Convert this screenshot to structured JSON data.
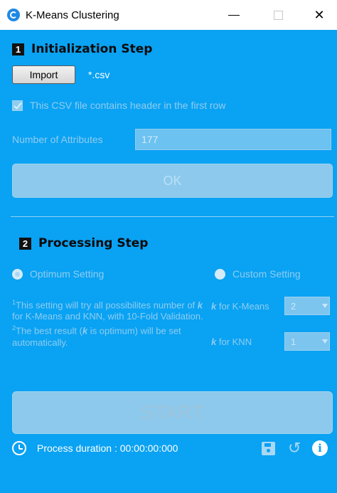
{
  "window": {
    "title": "K-Means Clustering",
    "min_glyph": "—",
    "max_glyph": "□",
    "close_glyph": "✕"
  },
  "init": {
    "step_number": "1",
    "title": "Initialization Step",
    "import_label": "Import",
    "file_label": "*.csv",
    "header_checkbox_label": "This CSV file contains header in the first row",
    "header_checked": true,
    "attributes_label": "Number of Attributes",
    "attributes_value": "177",
    "ok_label": "OK"
  },
  "processing": {
    "step_number": "2",
    "title": "Processing Step",
    "optimum_label": "Optimum Setting",
    "custom_label": "Custom Setting",
    "selected": "optimum",
    "info_line1_pre": "This setting will try all possibilites number of ",
    "info_line1_k": "k",
    "info_line1_post": " for K-Means and KNN, with 10-Fold Validation.",
    "info_line2_pre": "The best result (",
    "info_line2_k": "k",
    "info_line2_post": " is optimum) will be set automatically.",
    "sup1": "1",
    "sup2": "2",
    "k_symbol": "k",
    "k_kmeans_label": " for K-Means",
    "k_kmeans_value": "2",
    "k_knn_label": " for KNN",
    "k_knn_value": "1",
    "start_label": "START"
  },
  "footer": {
    "duration_text": "Process duration : 00:00:00:000",
    "icons": [
      "clock-icon",
      "save-icon",
      "reset-icon",
      "info-icon"
    ]
  },
  "colors": {
    "background": "#0aa2f3",
    "disabled_text": "#8fcdf0",
    "titlebar": "#ffffff"
  }
}
